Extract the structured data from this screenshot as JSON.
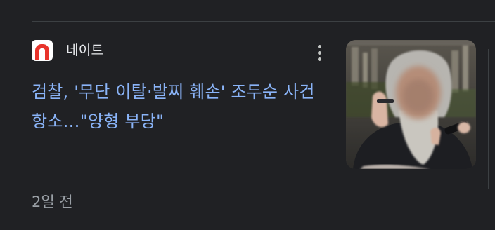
{
  "article": {
    "publisher": "네이트",
    "headline": "검찰, '무단 이탈·발찌 훼손' 조두순 사건 항소…\"양형 부당\"",
    "time": "2일 전"
  },
  "icons": {
    "publisher_logo": "nate-logo-icon",
    "more": "more-vert-icon"
  },
  "colors": {
    "background": "#202124",
    "headline": "#8ab4f8",
    "secondary_text": "#9aa0a6",
    "logo_red": "#e8332b"
  }
}
